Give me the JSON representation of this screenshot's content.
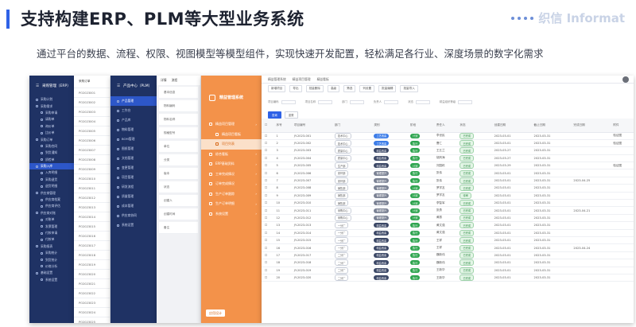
{
  "slide": {
    "title": "支持构建ERP、PLM等大型业务系统",
    "subtitle": "通过平台的数据、流程、权限、视图模型等模型组件，实现快速开发配置，轻松满足各行业、深度场景的数字化需求",
    "brand": "织信 Informat",
    "accent_color": "#2f62e6"
  },
  "panel1": {
    "title": "采购管理（ERP）",
    "items": [
      {
        "label": "采购计划",
        "sub": false,
        "active": false
      },
      {
        "label": "采购需求",
        "sub": false,
        "active": false
      },
      {
        "label": "采购申请",
        "sub": true,
        "active": false
      },
      {
        "label": "请购单",
        "sub": true,
        "active": false
      },
      {
        "label": "询价单",
        "sub": true,
        "active": false
      },
      {
        "label": "比价单",
        "sub": true,
        "active": false
      },
      {
        "label": "采购订单",
        "sub": false,
        "active": false
      },
      {
        "label": "采购合同",
        "sub": true,
        "active": false
      },
      {
        "label": "到货通知",
        "sub": true,
        "active": false
      },
      {
        "label": "质检单",
        "sub": true,
        "active": false
      },
      {
        "label": "采购入库",
        "sub": false,
        "active": true
      },
      {
        "label": "入库明细",
        "sub": true,
        "active": false
      },
      {
        "label": "采购退货",
        "sub": true,
        "active": false
      },
      {
        "label": "退货明细",
        "sub": true,
        "active": false
      },
      {
        "label": "供应商管理",
        "sub": false,
        "active": false
      },
      {
        "label": "供应商档案",
        "sub": true,
        "active": false
      },
      {
        "label": "供应商评估",
        "sub": true,
        "active": false
      },
      {
        "label": "供应商对账",
        "sub": false,
        "active": false
      },
      {
        "label": "对账单",
        "sub": true,
        "active": false
      },
      {
        "label": "发票管理",
        "sub": true,
        "active": false
      },
      {
        "label": "付款申请",
        "sub": true,
        "active": false
      },
      {
        "label": "付款单",
        "sub": true,
        "active": false
      },
      {
        "label": "采购报表",
        "sub": false,
        "active": false
      },
      {
        "label": "采购统计",
        "sub": true,
        "active": false
      },
      {
        "label": "到货统计",
        "sub": true,
        "active": false
      },
      {
        "label": "价格分析",
        "sub": true,
        "active": false
      },
      {
        "label": "基础设置",
        "sub": false,
        "active": false
      },
      {
        "label": "系统设置",
        "sub": true,
        "active": false
      }
    ]
  },
  "panel2": {
    "header": "采购订单",
    "rows": [
      "PO2023001",
      "PO2023002",
      "PO2023003",
      "PO2023004",
      "PO2023005",
      "PO2023006",
      "PO2023007",
      "PO2023008",
      "PO2023009",
      "PO2023010",
      "PO2023011",
      "PO2023012",
      "PO2023013",
      "PO2023014",
      "PO2023015",
      "PO2023016",
      "PO2023017",
      "PO2023018",
      "PO2023019",
      "PO2023020",
      "PO2023021",
      "PO2023022",
      "PO2023023",
      "PO2023024",
      "PO2023025"
    ]
  },
  "panel3": {
    "title": "产品中心（PLM）",
    "items": [
      {
        "label": "产品管理",
        "sub": false
      },
      {
        "label": "工作台",
        "sub": false
      },
      {
        "label": "产品库",
        "sub": false
      },
      {
        "label": "物料管理",
        "sub": false
      },
      {
        "label": "BOM管理",
        "sub": false
      },
      {
        "label": "图纸管理",
        "sub": false
      },
      {
        "label": "文档管理",
        "sub": false
      },
      {
        "label": "变更管理",
        "sub": false
      },
      {
        "label": "项目管理",
        "sub": false
      },
      {
        "label": "研发流程",
        "sub": false
      },
      {
        "label": "质量管理",
        "sub": false
      },
      {
        "label": "成本管理",
        "sub": false
      },
      {
        "label": "供应商协同",
        "sub": false
      },
      {
        "label": "系统设置",
        "sub": false
      }
    ]
  },
  "panel4": {
    "tabs": [
      "详情",
      "流程"
    ],
    "rows": [
      "基本信息",
      "物料编码",
      "物料名称",
      "规格型号",
      "单位",
      "分类",
      "版本",
      "状态",
      "创建人",
      "创建时间",
      "备注"
    ]
  },
  "panel5": {
    "title": "精益管理系统",
    "items": [
      {
        "label": "精益项目管理",
        "sub": false,
        "active": false
      },
      {
        "label": "精益项目看板",
        "sub": true,
        "active": false
      },
      {
        "label": "项目列表",
        "sub": true,
        "active": true
      },
      {
        "label": "综合看板",
        "sub": false,
        "active": false
      },
      {
        "label": "ERP基础资料",
        "sub": false,
        "active": false
      },
      {
        "label": "工单完成情况",
        "sub": false,
        "active": false
      },
      {
        "label": "订单完成情况",
        "sub": false,
        "active": false
      },
      {
        "label": "生产订单跟踪",
        "sub": false,
        "active": false
      },
      {
        "label": "生产订单明细",
        "sub": false,
        "active": false
      },
      {
        "label": "系统设置",
        "sub": false,
        "active": false
      }
    ],
    "footer": "应用设计"
  },
  "table": {
    "breadcrumb": [
      "精益管理系统",
      "精益项目管理",
      "精益看板"
    ],
    "tabs": [
      "新增项目",
      "导出",
      "批量删除",
      "高级",
      "筛选",
      "列设置",
      "批量编辑",
      "批量导入"
    ],
    "filters": [
      "项目编码",
      "项目名称",
      "部门",
      "负责人",
      "状态",
      "精益组织等级"
    ],
    "buttons": [
      "查询",
      "重置"
    ],
    "headers": [
      "序号",
      "项目编号",
      "部门",
      "类别",
      "阶段",
      "责任人",
      "状态",
      "创建日期",
      "截止日期",
      "完成日期",
      "附件"
    ],
    "rows": [
      [
        "1",
        "JY-2023-001",
        "技术中心",
        "工艺改善",
        "计划",
        "李世民",
        "已完成",
        "2023-03-01",
        "2023-03-31",
        "",
        "验证图"
      ],
      [
        "2",
        "JY-2023-002",
        "技术中心",
        "工艺改善",
        "执行",
        "曹仁",
        "已完成",
        "2023-03-01",
        "2023-03-31",
        "",
        "验证图"
      ],
      [
        "3",
        "JY-2023-003",
        "质量中心",
        "精益改善",
        "执行",
        "王五兰",
        "已完成",
        "2023-03-27",
        "2023-03-31",
        "",
        ""
      ],
      [
        "4",
        "JY-2023-004",
        "质量中心",
        "精益改善",
        "执行",
        "胡风海",
        "已完成",
        "2023-03-27",
        "2023-03-31",
        "",
        ""
      ],
      [
        "5",
        "JY-2023-005",
        "生产部",
        "精益改善",
        "计划",
        "刘国栋",
        "已完成",
        "2023-03-29",
        "2023-03-31",
        "",
        "验证图"
      ],
      [
        "6",
        "JY-2023-006",
        "安环部",
        "管理提升",
        "执行",
        "张伟",
        "已完成",
        "2023-03-01",
        "2023-03-31",
        "",
        ""
      ],
      [
        "7",
        "JY-2023-007",
        "安环部",
        "管理提升",
        "执行",
        "张伟",
        "已完成",
        "2023-03-01",
        "2023-03-31",
        "2023-04-25",
        ""
      ],
      [
        "8",
        "JY-2023-008",
        "销售部",
        "管理提升",
        "计划",
        "罗学友",
        "已完成",
        "2023-03-01",
        "2023-03-31",
        "",
        ""
      ],
      [
        "9",
        "JY-2023-009",
        "销售部",
        "管理提升",
        "计划",
        "罗学友",
        "待审",
        "2023-03-01",
        "2023-03-31",
        "",
        ""
      ],
      [
        "10",
        "JY-2023-010",
        "销售部",
        "管理提升",
        "计划",
        "李智军",
        "已完成",
        "2023-03-01",
        "2023-03-31",
        "",
        ""
      ],
      [
        "11",
        "JY-2023-011",
        "采购中心",
        "管理提升",
        "计划",
        "张勇",
        "已完成",
        "2023-03-01",
        "2023-03-31",
        "2023-04-21",
        ""
      ],
      [
        "12",
        "JY-2023-012",
        "采购中心",
        "管理提升",
        "计划",
        "黄振",
        "已完成",
        "2023-03-01",
        "2023-03-31",
        "",
        ""
      ],
      [
        "13",
        "JY-2023-013",
        "一分厂",
        "精益改善",
        "执行",
        "黄文强",
        "已完成",
        "2023-03-01",
        "2023-03-31",
        "",
        ""
      ],
      [
        "14",
        "JY-2023-014",
        "一分厂",
        "精益改善",
        "执行",
        "黄文强",
        "已完成",
        "2023-03-01",
        "2023-03-31",
        "",
        ""
      ],
      [
        "15",
        "JY-2023-015",
        "一分厂",
        "精益改善",
        "执行",
        "王祥",
        "已完成",
        "2023-03-01",
        "2023-03-31",
        "",
        ""
      ],
      [
        "16",
        "JY-2023-016",
        "一分厂",
        "精益改善",
        "执行",
        "王祥",
        "已完成",
        "2023-03-01",
        "2023-03-31",
        "2023-04-24",
        ""
      ],
      [
        "17",
        "JY-2023-017",
        "二分厂",
        "精益改善",
        "执行",
        "魏新伟",
        "已完成",
        "2023-03-01",
        "2023-03-31",
        "",
        ""
      ],
      [
        "18",
        "JY-2023-018",
        "二分厂",
        "精益改善",
        "执行",
        "魏新伟",
        "已完成",
        "2023-03-01",
        "2023-03-31",
        "",
        ""
      ],
      [
        "19",
        "JY-2023-019",
        "二分厂",
        "精益改善",
        "执行",
        "王新华",
        "已完成",
        "2023-03-01",
        "2023-03-31",
        "",
        ""
      ],
      [
        "20",
        "JY-2023-020",
        "二分厂",
        "精益改善",
        "执行",
        "王新华",
        "已完成",
        "2023-03-01",
        "2023-03-31",
        "",
        ""
      ]
    ]
  }
}
